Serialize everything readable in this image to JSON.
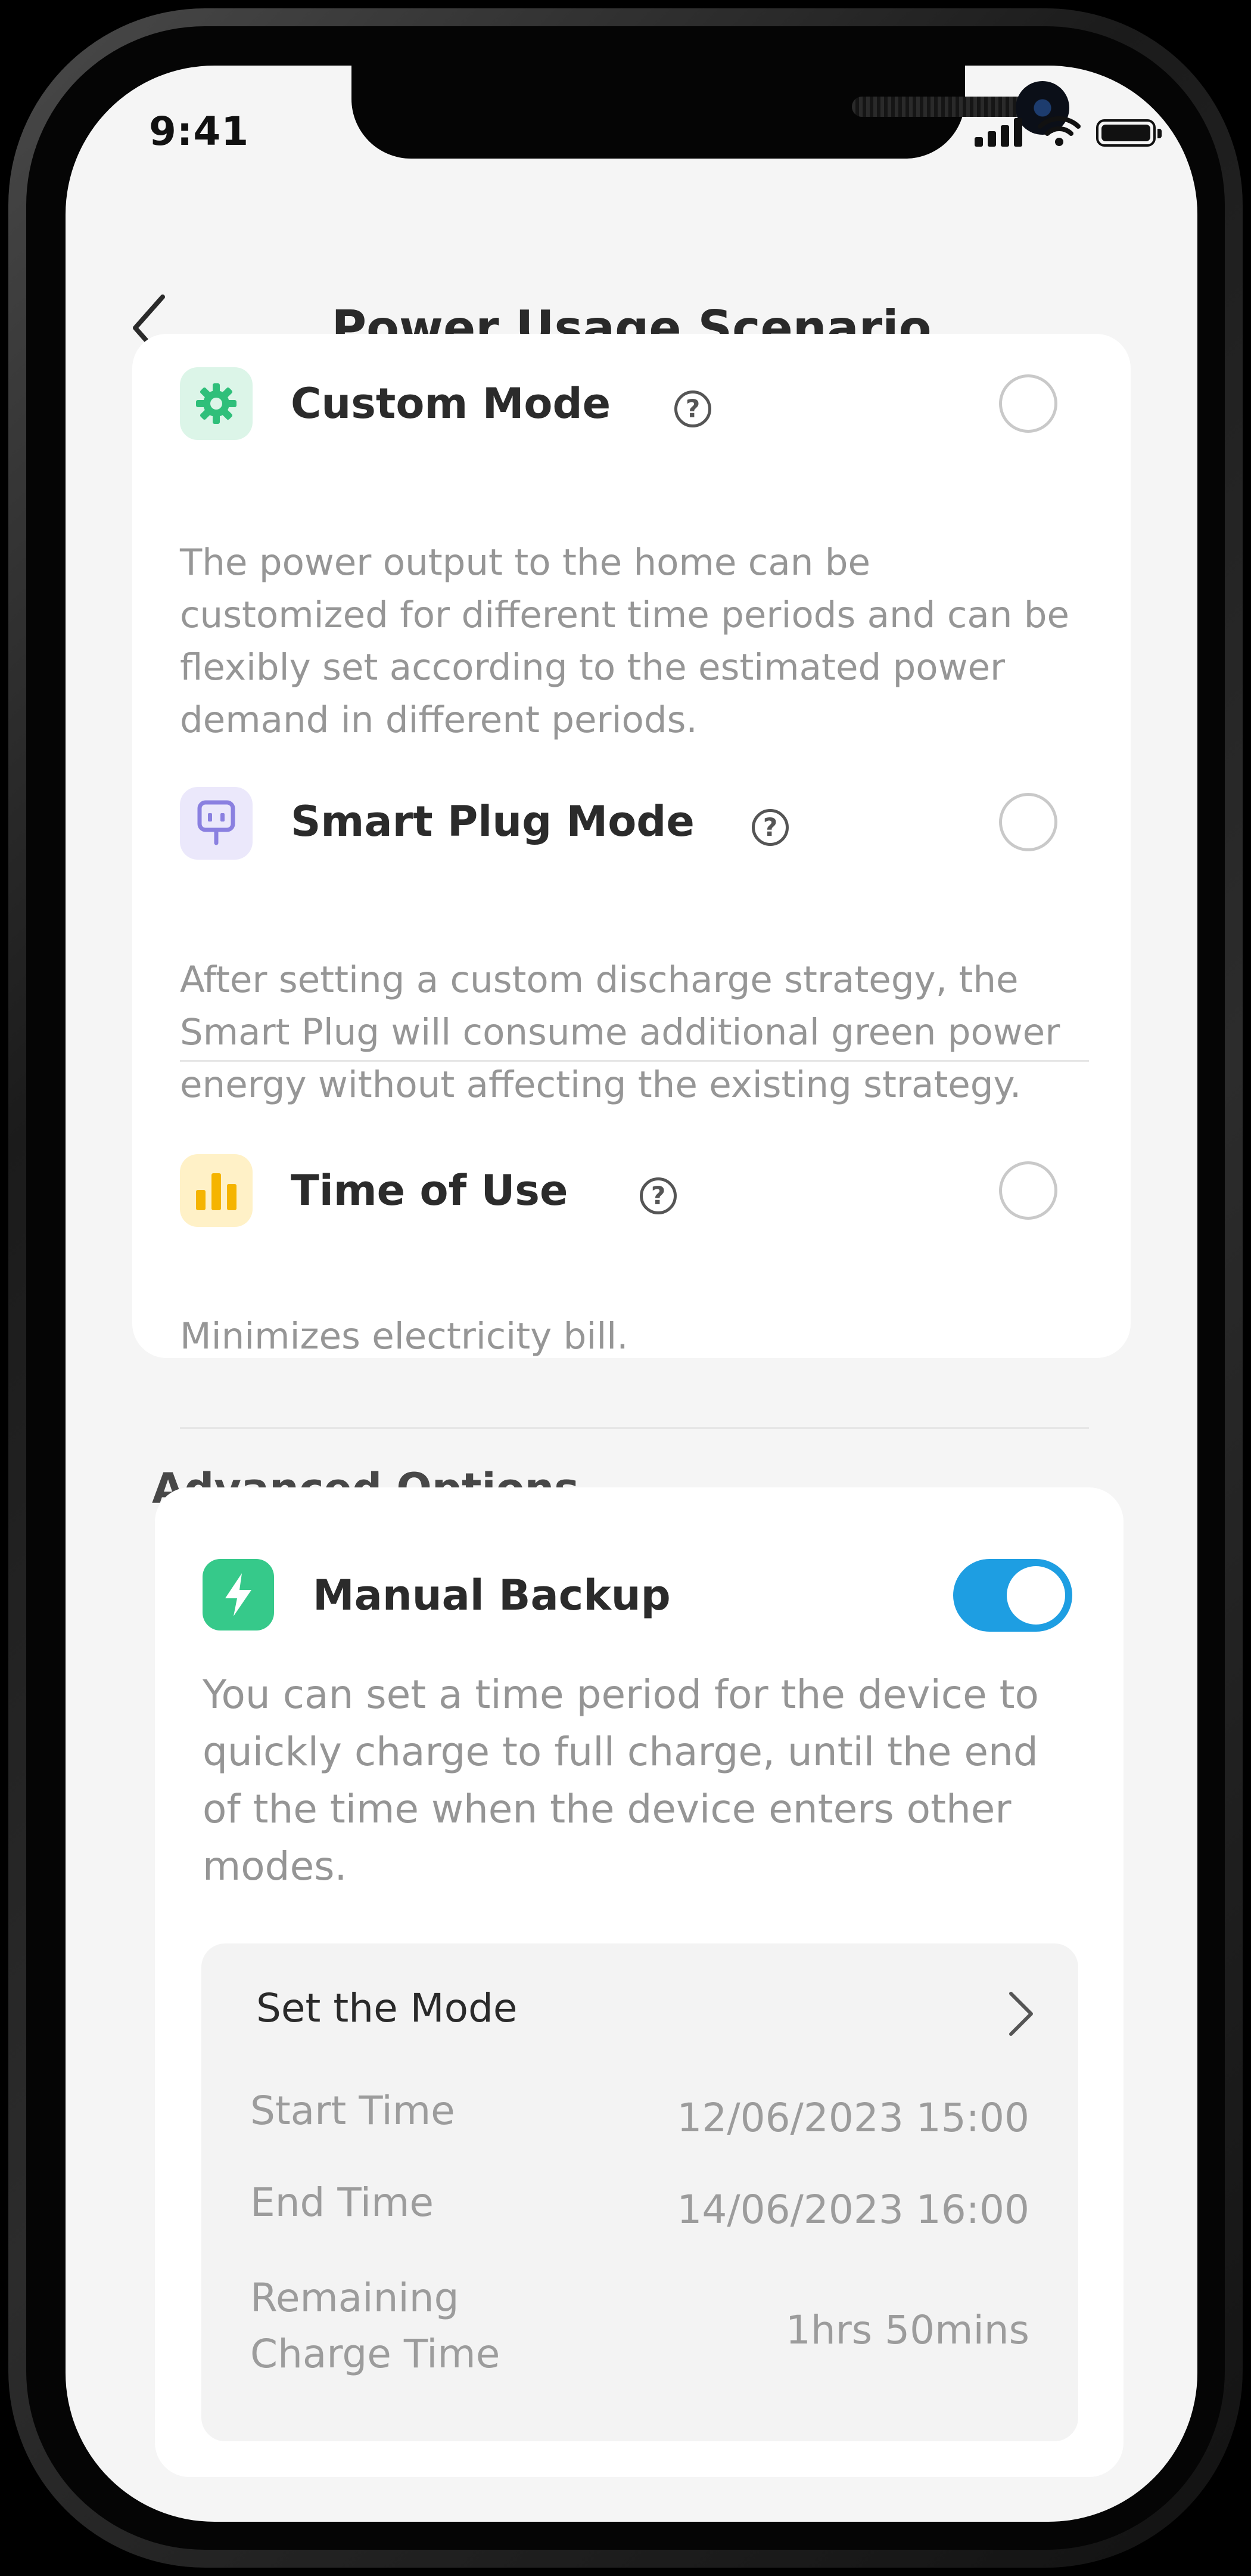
{
  "status_bar": {
    "time": "9:41"
  },
  "header": {
    "title": "Power Usage Scenario"
  },
  "modes": [
    {
      "title": "Custom Mode",
      "description": "The power output to the home can be customized for different time periods and can be flexibly set according to the estimated power demand in different periods.",
      "selected": false,
      "icon": "gear-icon",
      "icon_color": "#2fbf7a",
      "icon_bg": "#dcf5e8"
    },
    {
      "title": "Smart Plug Mode",
      "description": "After setting a custom discharge strategy, the Smart Plug will consume additional green power energy without affecting the existing strategy.",
      "selected": false,
      "icon": "plug-icon",
      "icon_color": "#8a80e0",
      "icon_bg": "#ebe8fb"
    },
    {
      "title": "Time of Use",
      "description": "Minimizes electricity bill.",
      "selected": false,
      "icon": "bar-chart-icon",
      "icon_color": "#f5b400",
      "icon_bg": "#fff1c7"
    }
  ],
  "advanced": {
    "section_title": "Advanced Options",
    "manual_backup": {
      "title": "Manual Backup",
      "enabled": true,
      "toggle_color": "#1e9ee2",
      "description": "You can set a time period for the device to quickly charge to full charge, until the end of the time when the device enters other modes.",
      "set_mode_label": "Set the Mode",
      "start_label": "Start Time",
      "start_value": "12/06/2023 15:00",
      "end_label": "End Time",
      "end_value": "14/06/2023 16:00",
      "remaining_label": "Remaining Charge Time",
      "remaining_value": "1hrs 50mins"
    }
  }
}
